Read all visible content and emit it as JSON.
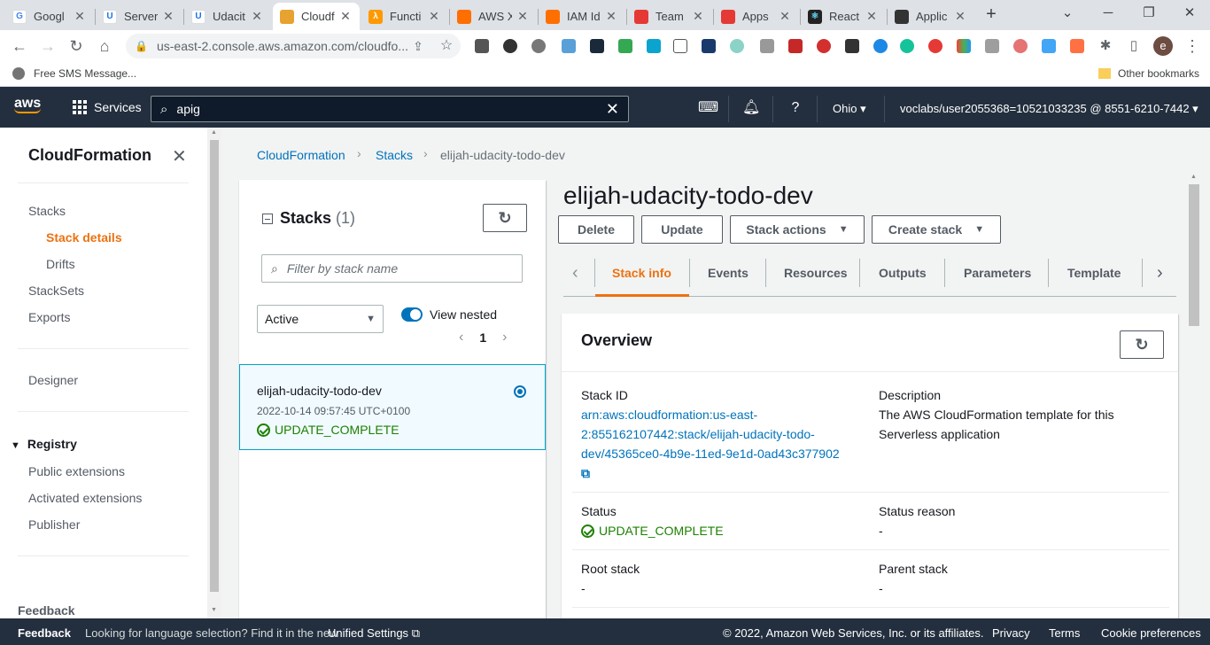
{
  "browser": {
    "tabs": [
      {
        "label": "Googl",
        "color": "#4285f4",
        "glyph": "G"
      },
      {
        "label": "Server",
        "color": "#1a73e8",
        "glyph": "U"
      },
      {
        "label": "Udacit",
        "color": "#1a73e8",
        "glyph": "U"
      },
      {
        "label": "Cloudf",
        "color": "#e7a32f",
        "glyph": ""
      },
      {
        "label": "Functi",
        "color": "#ff9900",
        "glyph": "λ"
      },
      {
        "label": "AWS X",
        "color": "#ff6f00",
        "glyph": ""
      },
      {
        "label": "IAM Id",
        "color": "#ff6f00",
        "glyph": ""
      },
      {
        "label": "Team",
        "color": "#e53935",
        "glyph": ""
      },
      {
        "label": "Apps",
        "color": "#e53935",
        "glyph": ""
      },
      {
        "label": "React a",
        "color": "#00bcd4",
        "glyph": "⚛"
      },
      {
        "label": "Applic",
        "color": "#333333",
        "glyph": ""
      }
    ],
    "url": "us-east-2.console.aws.amazon.com/cloudfo...",
    "bookmark": "Free SMS Message...",
    "other_bookmarks": "Other bookmarks",
    "profile_initial": "e"
  },
  "aws_header": {
    "logo": "aws",
    "services": "Services",
    "search_value": "apig",
    "region": "Ohio ▾",
    "account": "voclabs/user2055368=10521033235 @ 8551-6210-7442 ▾"
  },
  "sidebar": {
    "title": "CloudFormation",
    "items": [
      {
        "label": "Stacks"
      },
      {
        "label": "Stack details"
      },
      {
        "label": "Drifts"
      },
      {
        "label": "StackSets"
      },
      {
        "label": "Exports"
      },
      {
        "label": "Designer"
      },
      {
        "label": "Registry"
      },
      {
        "label": "Public extensions"
      },
      {
        "label": "Activated extensions"
      },
      {
        "label": "Publisher"
      },
      {
        "label": "Feedback"
      }
    ]
  },
  "breadcrumb": [
    "CloudFormation",
    "Stacks",
    "elijah-udacity-todo-dev"
  ],
  "stack_list": {
    "header": "Stacks",
    "count": "(1)",
    "filter_placeholder": "Filter by stack name",
    "status_filter": "Active",
    "view_nested": "View nested",
    "page": "1",
    "stack": {
      "name": "elijah-udacity-todo-dev",
      "time": "2022-10-14 09:57:45 UTC+0100",
      "status": "UPDATE_COMPLETE"
    }
  },
  "detail": {
    "title": "elijah-udacity-todo-dev",
    "buttons": [
      "Delete",
      "Update",
      "Stack actions",
      "Create stack"
    ],
    "tabs": [
      "Stack info",
      "Events",
      "Resources",
      "Outputs",
      "Parameters",
      "Template"
    ],
    "overview": {
      "title": "Overview",
      "stack_id_label": "Stack ID",
      "stack_id_lines": [
        "arn:aws:cloudformation:us-east-",
        "2:855162107442:stack/elijah-udacity-todo-",
        "dev/45365ce0-4b9e-11ed-9e1d-0ad43c377902"
      ],
      "description_label": "Description",
      "description_lines": [
        "The AWS CloudFormation template for this",
        "Serverless application"
      ],
      "status_label": "Status",
      "status_value": "UPDATE_COMPLETE",
      "status_reason_label": "Status reason",
      "status_reason_value": "-",
      "root_stack_label": "Root stack",
      "root_stack_value": "-",
      "parent_stack_label": "Parent stack",
      "parent_stack_value": "-"
    }
  },
  "footer": {
    "feedback": "Feedback",
    "lang_text": "Looking for language selection? Find it in the new",
    "unified": "Unified Settings",
    "copyright": "© 2022, Amazon Web Services, Inc. or its affiliates.",
    "privacy": "Privacy",
    "terms": "Terms",
    "cookies": "Cookie preferences"
  },
  "colors": {
    "aws_header": "#232f3e",
    "accent_orange": "#ec7211",
    "link_blue": "#0073bb",
    "success_green": "#1d8102"
  }
}
